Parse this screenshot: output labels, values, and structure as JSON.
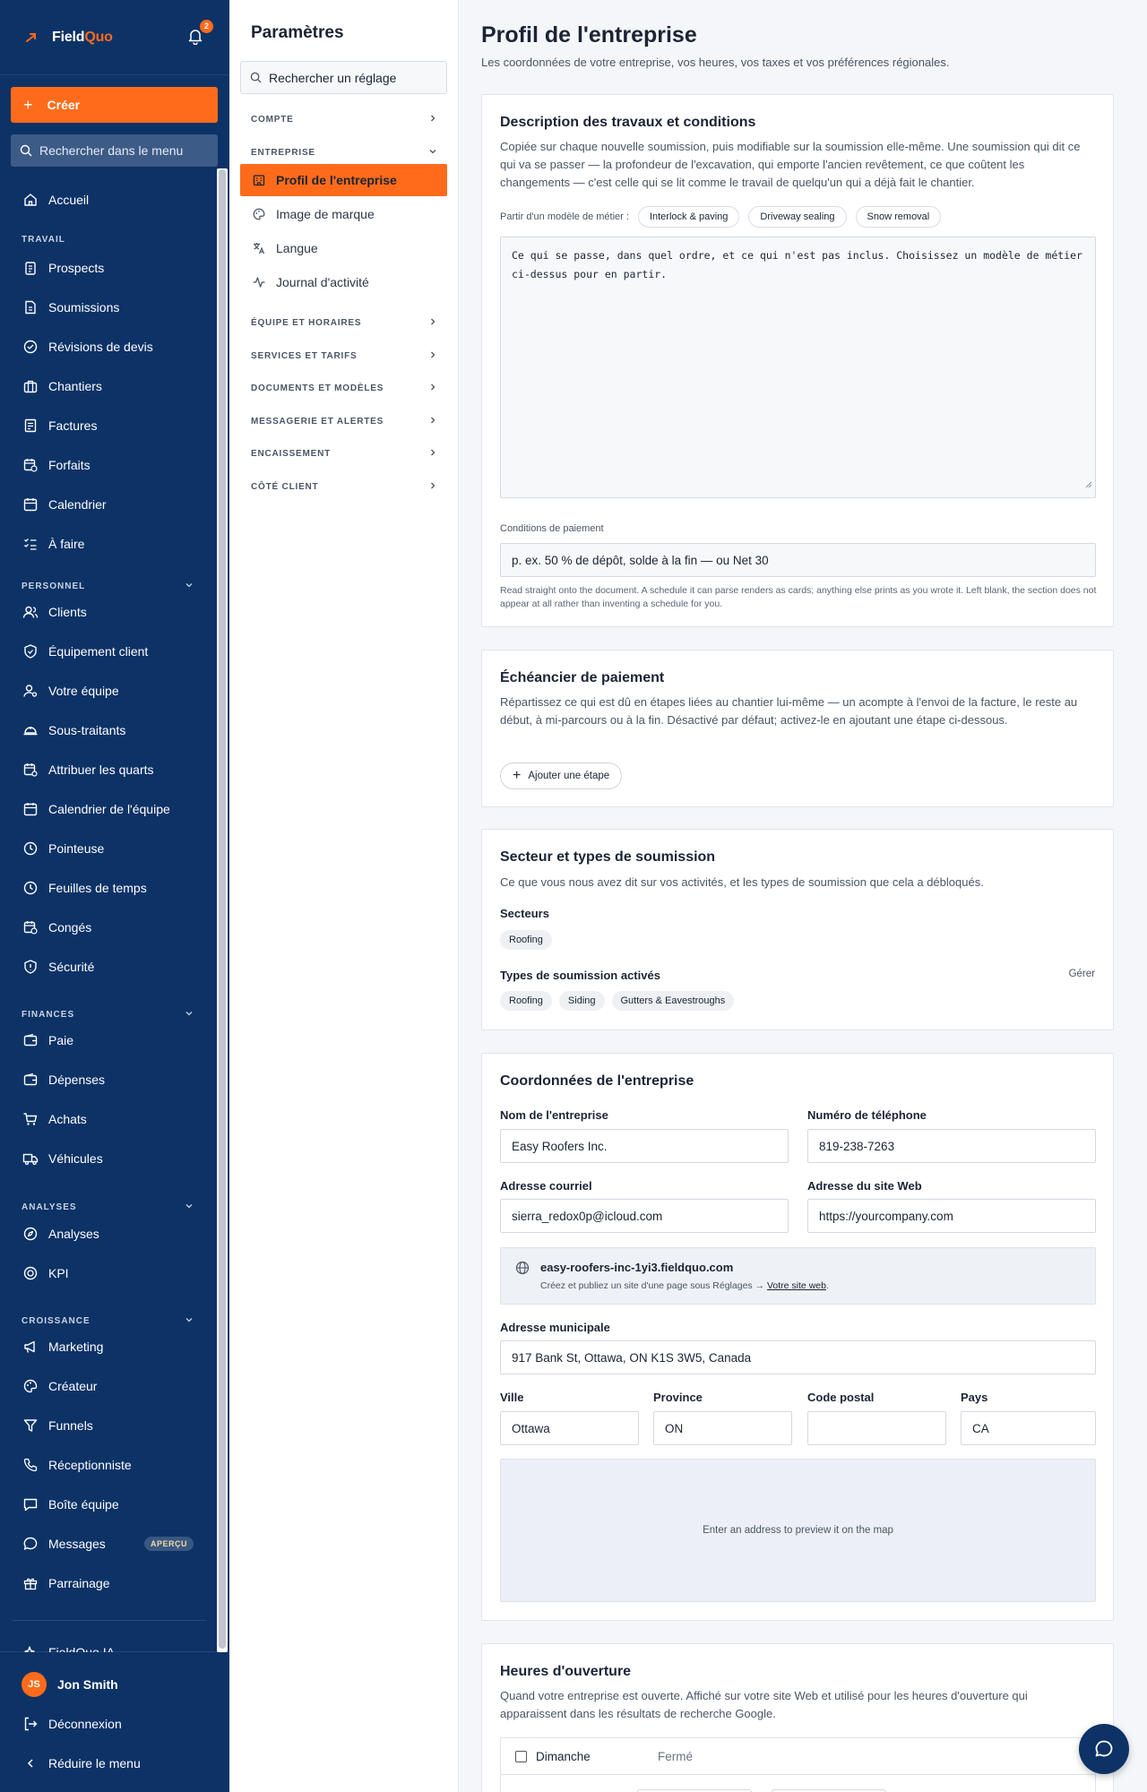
{
  "brand": {
    "name_part1": "Field",
    "name_part2": "Quo",
    "accent": "#ff6b1a",
    "sidebar_bg": "#0d3266"
  },
  "notifications": {
    "count": "2"
  },
  "sidebar": {
    "create_label": "Créer",
    "search_placeholder": "Rechercher dans le menu",
    "home": "Accueil",
    "sections": {
      "travail": "TRAVAIL",
      "personnel": "PERSONNEL",
      "finances": "FINANCES",
      "analyses": "ANALYSES",
      "croissance": "CROISSANCE"
    },
    "items": {
      "prospects": "Prospects",
      "soumissions": "Soumissions",
      "revisions": "Révisions de devis",
      "chantiers": "Chantiers",
      "factures": "Factures",
      "forfaits": "Forfaits",
      "calendrier": "Calendrier",
      "a_faire": "À faire",
      "clients": "Clients",
      "equipement": "Équipement client",
      "equipe": "Votre équipe",
      "sous_traitants": "Sous-traitants",
      "quarts": "Attribuer les quarts",
      "calendrier_equipe": "Calendrier de l'équipe",
      "pointeuse": "Pointeuse",
      "feuilles": "Feuilles de temps",
      "conges": "Congés",
      "securite": "Sécurité",
      "paie": "Paie",
      "depenses": "Dépenses",
      "achats": "Achats",
      "vehicules": "Véhicules",
      "analyses": "Analyses",
      "kpi": "KPI",
      "marketing": "Marketing",
      "createur": "Créateur",
      "funnels": "Funnels",
      "receptionniste": "Réceptionniste",
      "boite": "Boîte équipe",
      "messages": "Messages",
      "messages_badge": "APERÇU",
      "parrainage": "Parrainage",
      "ia": "FieldQuo IA"
    },
    "user": {
      "initials": "JS",
      "name": "Jon Smith"
    },
    "logout": "Déconnexion",
    "collapse": "Réduire le menu"
  },
  "settings": {
    "title": "Paramètres",
    "search_placeholder": "Rechercher un réglage",
    "groups": {
      "compte": "COMPTE",
      "entreprise": "ENTREPRISE",
      "equipe": "ÉQUIPE ET HORAIRES",
      "services": "SERVICES ET TARIFS",
      "documents": "DOCUMENTS ET MODÈLES",
      "messagerie": "MESSAGERIE ET ALERTES",
      "encaissement": "ENCAISSEMENT",
      "client": "CÔTÉ CLIENT"
    },
    "items": {
      "profil": "Profil de l'entreprise",
      "image": "Image de marque",
      "langue": "Langue",
      "journal": "Journal d'activité"
    }
  },
  "main": {
    "title": "Profil de l'entreprise",
    "subtitle": "Les coordonnées de votre entreprise, vos heures, vos taxes et vos préférences régionales.",
    "work": {
      "title": "Description des travaux et conditions",
      "desc": "Copiée sur chaque nouvelle soumission, puis modifiable sur la soumission elle-même. Une soumission qui dit ce qui va se passer — la profondeur de l'excavation, qui emporte l'ancien revêtement, ce que coûtent les changements — c'est celle qui se lit comme le travail de quelqu'un qui a déjà fait le chantier.",
      "template_label": "Partir d'un modèle de métier :",
      "templates": [
        "Interlock & paving",
        "Driveway sealing",
        "Snow removal"
      ],
      "placeholder": "Ce qui se passe, dans quel ordre, et ce qui n'est pas inclus. Choisissez un modèle de métier ci-dessus pour en partir.",
      "payment_label": "Conditions de paiement",
      "payment_placeholder": "p. ex. 50 % de dépôt, solde à la fin — ou Net 30",
      "payment_hint": "Read straight onto the document. A schedule it can parse renders as cards; anything else prints as you wrote it. Left blank, the section does not appear at all rather than inventing a schedule for you."
    },
    "schedule": {
      "title": "Échéancier de paiement",
      "desc": "Répartissez ce qui est dû en étapes liées au chantier lui-même — un acompte à l'envoi de la facture, le reste au début, à mi-parcours ou à la fin. Désactivé par défaut; activez-le en ajoutant une étape ci-dessous.",
      "add_step": "Ajouter une étape"
    },
    "sector": {
      "title": "Secteur et types de soumission",
      "desc": "Ce que vous nous avez dit sur vos activités, et les types de soumission que cela a débloqués.",
      "sectors_label": "Secteurs",
      "sectors": [
        "Roofing"
      ],
      "types_label": "Types de soumission activés",
      "manage": "Gérer",
      "types": [
        "Roofing",
        "Siding",
        "Gutters & Eavestroughs"
      ]
    },
    "contact": {
      "title": "Coordonnées de l'entreprise",
      "company_label": "Nom de l'entreprise",
      "company_value": "Easy Roofers Inc.",
      "phone_label": "Numéro de téléphone",
      "phone_value": "819-238-7263",
      "email_label": "Adresse courriel",
      "email_value": "sierra_redox0p@icloud.com",
      "website_label": "Adresse du site Web",
      "website_placeholder": "https://yourcompany.com",
      "site_url": "easy-roofers-inc-1yi3.fieldquo.com",
      "site_note": "Créez et publiez un site d'une page sous Réglages →",
      "site_link": "Votre site web",
      "site_note_end": ".",
      "address_label": "Adresse municipale",
      "address_value": "917 Bank St, Ottawa, ON K1S 3W5, Canada",
      "city_label": "Ville",
      "city_value": "Ottawa",
      "province_label": "Province",
      "province_value": "ON",
      "postal_label": "Code postal",
      "postal_value": "",
      "country_label": "Pays",
      "country_value": "CA",
      "map_text": "Enter an address to preview it on the map"
    },
    "hours": {
      "title": "Heures d'ouverture",
      "desc": "Quand votre entreprise est ouverte. Affiché sur votre site Web et utilisé pour les heures d'ouverture qui apparaissent dans les résultats de recherche Google.",
      "day": "Dimanche",
      "state": "Fermé"
    }
  }
}
